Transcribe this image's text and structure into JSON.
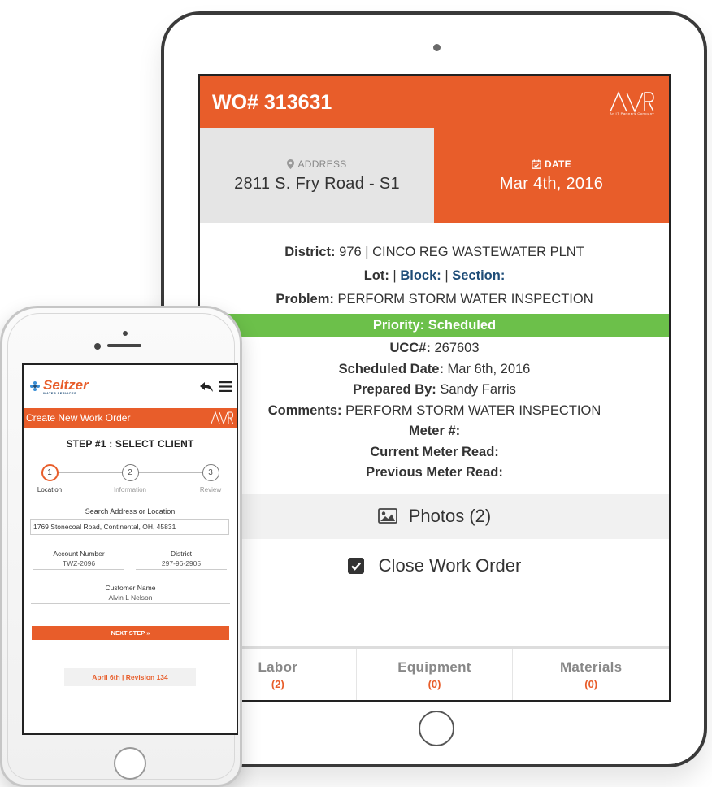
{
  "tablet": {
    "wo_title": "WO# 313631",
    "logo_text": "AVR",
    "logo_subtext": "An IT Partners Company",
    "address_label": "ADDRESS",
    "address_value": "2811 S. Fry Road - S1",
    "date_label": "DATE",
    "date_value": "Mar 4th, 2016",
    "district_label": "District:",
    "district_value": "976 | CINCO REG WASTEWATER PLNT",
    "lot_label": "Lot:",
    "block_label": "Block:",
    "section_label": "Section:",
    "problem_label": "Problem:",
    "problem_value": "PERFORM STORM WATER INSPECTION",
    "priority": "Priority: Scheduled",
    "ucc_label": "UCC#:",
    "ucc_value": "267603",
    "scheduled_label": "Scheduled Date:",
    "scheduled_value": "Mar 6th, 2016",
    "prepared_label": "Prepared By:",
    "prepared_value": "Sandy Farris",
    "comments_label": "Comments:",
    "comments_value": "PERFORM STORM WATER INSPECTION",
    "meter_label": "Meter #:",
    "current_meter_label": "Current Meter Read:",
    "previous_meter_label": "Previous Meter Read:",
    "photos_label": "Photos (2)",
    "close_label": "Close Work Order",
    "tabs": [
      {
        "label": "Labor",
        "count": "(2)"
      },
      {
        "label": "Equipment",
        "count": "(0)"
      },
      {
        "label": "Materials",
        "count": "(0)"
      }
    ]
  },
  "phone": {
    "brand_name": "Seltzer",
    "brand_sub": "WATER SERVICES",
    "header_title": "Create New Work Order",
    "logo_text": "AVR",
    "step_title": "STEP #1 : SELECT CLIENT",
    "steps": [
      {
        "num": "1",
        "label": "Location"
      },
      {
        "num": "2",
        "label": "Information"
      },
      {
        "num": "3",
        "label": "Review"
      }
    ],
    "search_label": "Search Address or Location",
    "search_value": "1769 Stonecoal Road, Continental, OH, 45831",
    "account_label": "Account Number",
    "account_value": "TWZ-2096",
    "district_label": "District",
    "district_value": "297-96-2905",
    "customer_label": "Customer Name",
    "customer_value": "Alvin L Nelson",
    "next_button": "NEXT STEP »",
    "revision": "April 6th | Revision 134"
  },
  "colors": {
    "accent": "#e85d2a",
    "priority_green": "#6cc04a",
    "link_blue": "#1f4d78",
    "brand_blue": "#3a8fd6"
  }
}
